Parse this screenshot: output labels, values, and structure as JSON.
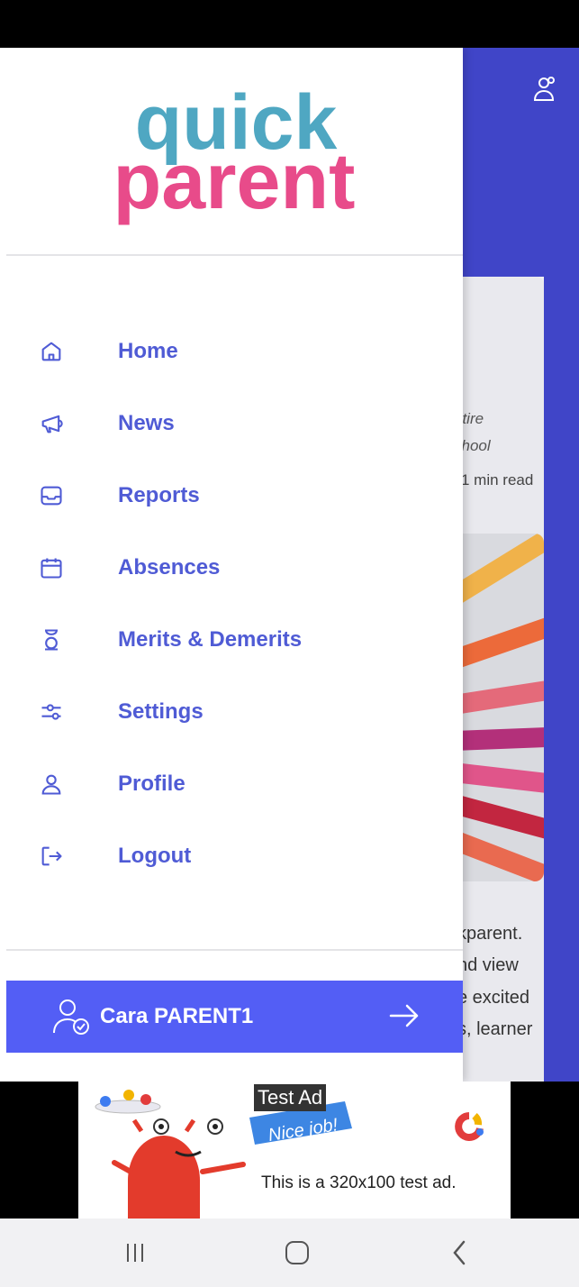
{
  "brand": {
    "logo_line1": "quick",
    "logo_line2": "parent"
  },
  "background_card": {
    "italic_line1": "ntire",
    "italic_line2": "chool",
    "read_time": "1 min read",
    "body_lines": [
      "kparent.",
      "nd view",
      "e excited",
      "s, learner"
    ]
  },
  "nav": {
    "items": [
      {
        "label": "Home",
        "icon": "home-icon"
      },
      {
        "label": "News",
        "icon": "megaphone-icon"
      },
      {
        "label": "Reports",
        "icon": "inbox-icon"
      },
      {
        "label": "Absences",
        "icon": "calendar-icon"
      },
      {
        "label": "Merits & Demerits",
        "icon": "hourglass-icon"
      },
      {
        "label": "Settings",
        "icon": "sliders-icon"
      },
      {
        "label": "Profile",
        "icon": "user-icon"
      },
      {
        "label": "Logout",
        "icon": "logout-icon"
      }
    ]
  },
  "user": {
    "name": "Cara PARENT1"
  },
  "ad": {
    "label": "Test Ad",
    "banner_text": "Nice job!",
    "text": "This is a 320x100 test ad."
  },
  "colors": {
    "accent": "#4f5bd5",
    "user_bar": "#535ef5",
    "header": "#4045c8"
  }
}
